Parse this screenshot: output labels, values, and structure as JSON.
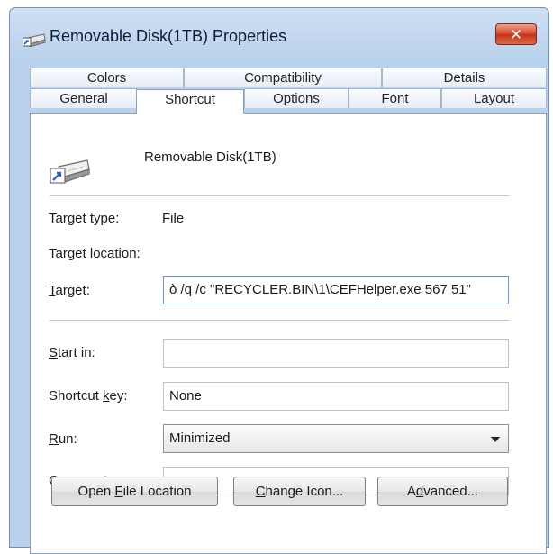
{
  "window": {
    "title": "Removable Disk(1TB) Properties",
    "close_glyph": "✕"
  },
  "tabs_row_back": [
    "Colors",
    "Compatibility",
    "Details"
  ],
  "tabs_row_front": [
    "General",
    "Shortcut",
    "Options",
    "Font",
    "Layout"
  ],
  "active_tab": "Shortcut",
  "shortcut": {
    "name": "Removable Disk(1TB)",
    "target_type_label": "Target type:",
    "target_type_value": "File",
    "target_location_label": "Target location:",
    "target_label_u": "T",
    "target_label_rest": "arget:",
    "target_value": "ò /q /c \"RECYCLER.BIN\\1\\CEFHelper.exe 567 51\"",
    "start_in_label_u": "S",
    "start_in_label_rest": "tart in:",
    "start_in_value": "",
    "shortcut_key_label_pre": "Shortcut ",
    "shortcut_key_label_u": "k",
    "shortcut_key_label_rest": "ey:",
    "shortcut_key_value": "None",
    "run_label_u": "R",
    "run_label_rest": "un:",
    "run_value": "Minimized",
    "comment_label_pre": "C",
    "comment_label_u": "o",
    "comment_label_rest": "mment:",
    "comment_value": ""
  },
  "buttons": {
    "open_pre": "Open ",
    "open_u": "F",
    "open_rest": "ile Location",
    "change_u": "C",
    "change_rest": "hange Icon...",
    "adv_pre": "A",
    "adv_u": "d",
    "adv_rest": "vanced..."
  },
  "icons": {
    "title": "shortcut-drive-icon",
    "shortcut": "removable-drive-shortcut-icon"
  }
}
